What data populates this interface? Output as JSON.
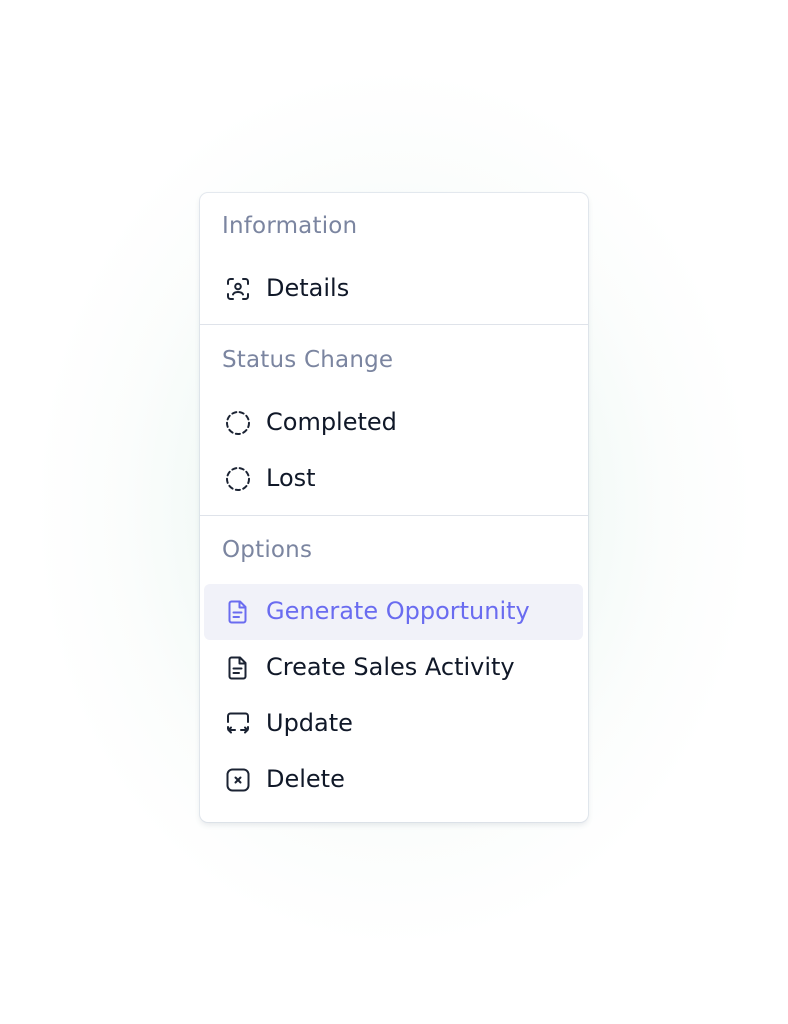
{
  "menu": {
    "sections": {
      "information": {
        "title": "Information",
        "items": [
          {
            "label": "Details",
            "icon": "user-scan-icon"
          }
        ]
      },
      "status": {
        "title": "Status Change",
        "items": [
          {
            "label": "Completed",
            "icon": "dashed-circle-icon"
          },
          {
            "label": "Lost",
            "icon": "dashed-circle-icon"
          }
        ]
      },
      "options": {
        "title": "Options",
        "items": [
          {
            "label": "Generate Opportunity",
            "icon": "document-icon",
            "active": true
          },
          {
            "label": "Create Sales Activity",
            "icon": "document-icon"
          },
          {
            "label": "Update",
            "icon": "update-arrows-icon"
          },
          {
            "label": "Delete",
            "icon": "x-square-icon"
          }
        ]
      }
    },
    "colors": {
      "section_title": "#7b85a0",
      "item_text": "#101828",
      "active_text": "#6a6cf0",
      "active_bg": "#f1f2f9",
      "divider": "#dfe3ea"
    }
  }
}
